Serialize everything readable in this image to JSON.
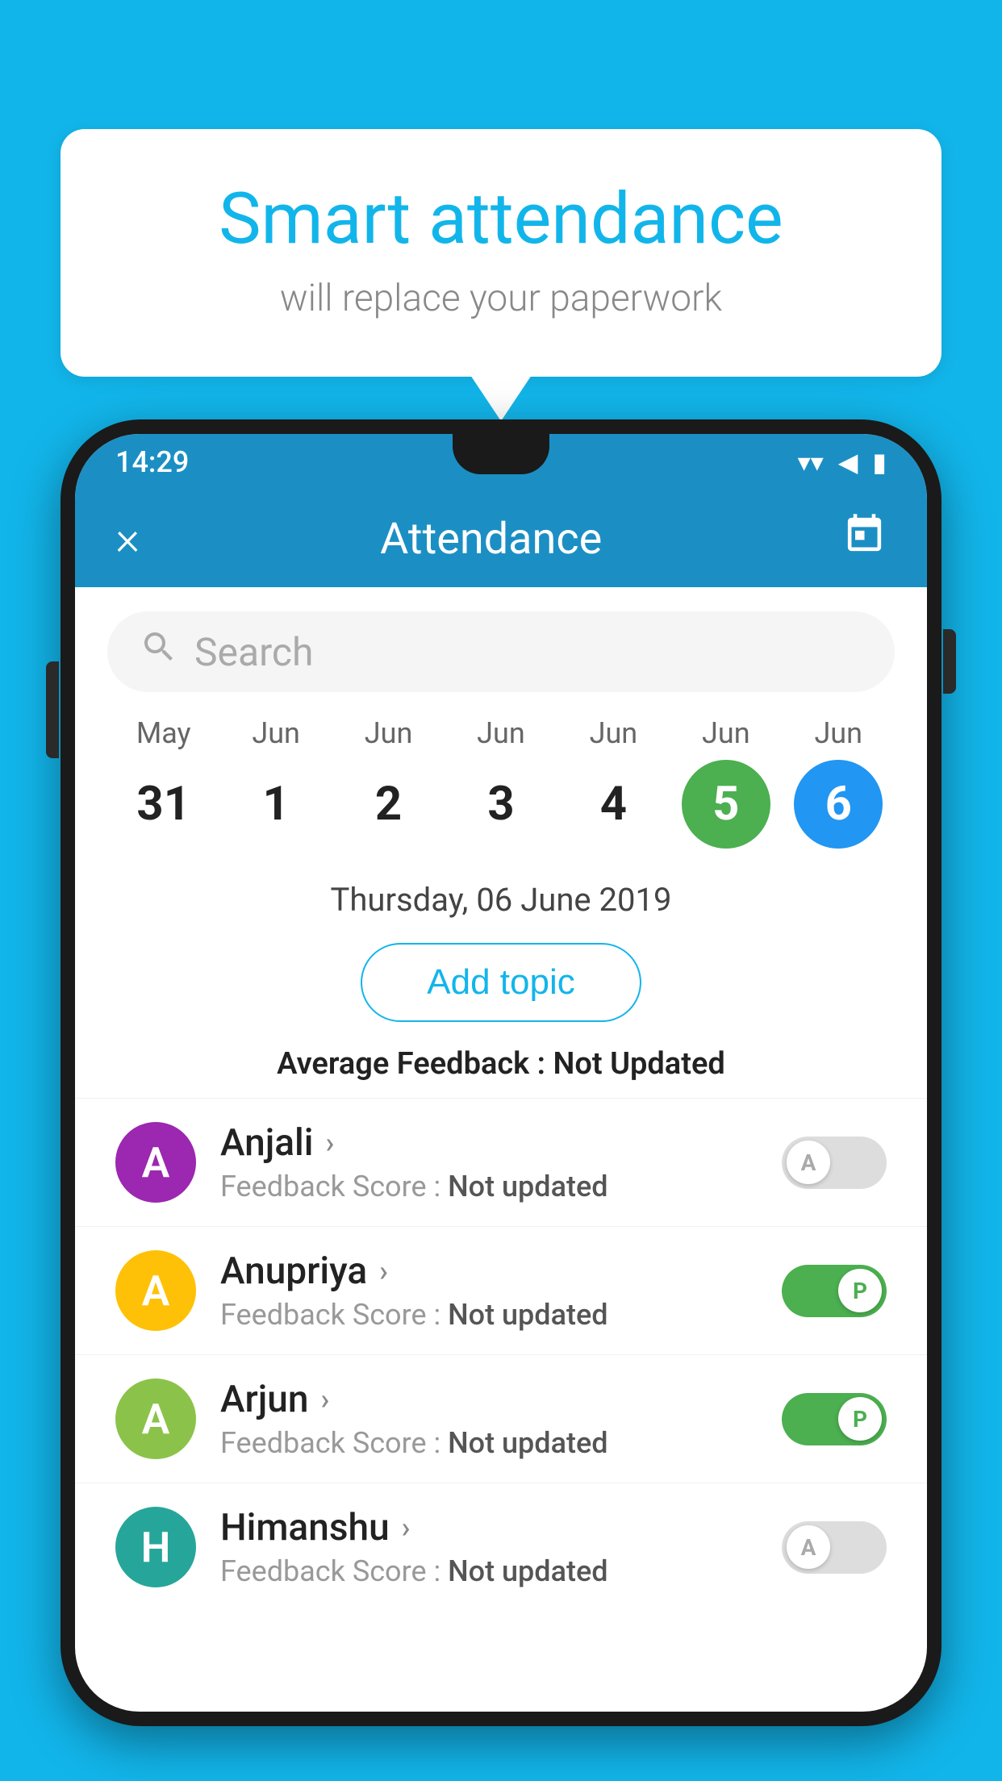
{
  "background_color": "#12b5ea",
  "bubble": {
    "title": "Smart attendance",
    "subtitle": "will replace your paperwork"
  },
  "status_bar": {
    "time": "14:29"
  },
  "header": {
    "close_label": "×",
    "title": "Attendance",
    "calendar_icon": "calendar"
  },
  "search": {
    "placeholder": "Search"
  },
  "date_selector": {
    "dates": [
      {
        "month": "May",
        "day": "31",
        "state": "normal"
      },
      {
        "month": "Jun",
        "day": "1",
        "state": "normal"
      },
      {
        "month": "Jun",
        "day": "2",
        "state": "normal"
      },
      {
        "month": "Jun",
        "day": "3",
        "state": "normal"
      },
      {
        "month": "Jun",
        "day": "4",
        "state": "normal"
      },
      {
        "month": "Jun",
        "day": "5",
        "state": "green"
      },
      {
        "month": "Jun",
        "day": "6",
        "state": "blue"
      }
    ]
  },
  "selected_date_label": "Thursday, 06 June 2019",
  "add_topic_label": "Add topic",
  "average_feedback": {
    "label": "Average Feedback :",
    "value": "Not Updated"
  },
  "students": [
    {
      "name": "Anjali",
      "avatar_letter": "A",
      "avatar_color": "purple",
      "feedback_label": "Feedback Score :",
      "feedback_value": "Not updated",
      "toggle_state": "off",
      "toggle_letter": "A"
    },
    {
      "name": "Anupriya",
      "avatar_letter": "A",
      "avatar_color": "yellow",
      "feedback_label": "Feedback Score :",
      "feedback_value": "Not updated",
      "toggle_state": "on",
      "toggle_letter": "P"
    },
    {
      "name": "Arjun",
      "avatar_letter": "A",
      "avatar_color": "green",
      "feedback_label": "Feedback Score :",
      "feedback_value": "Not updated",
      "toggle_state": "on",
      "toggle_letter": "P"
    },
    {
      "name": "Himanshu",
      "avatar_letter": "H",
      "avatar_color": "teal",
      "feedback_label": "Feedback Score :",
      "feedback_value": "Not updated",
      "toggle_state": "off",
      "toggle_letter": "A"
    }
  ]
}
